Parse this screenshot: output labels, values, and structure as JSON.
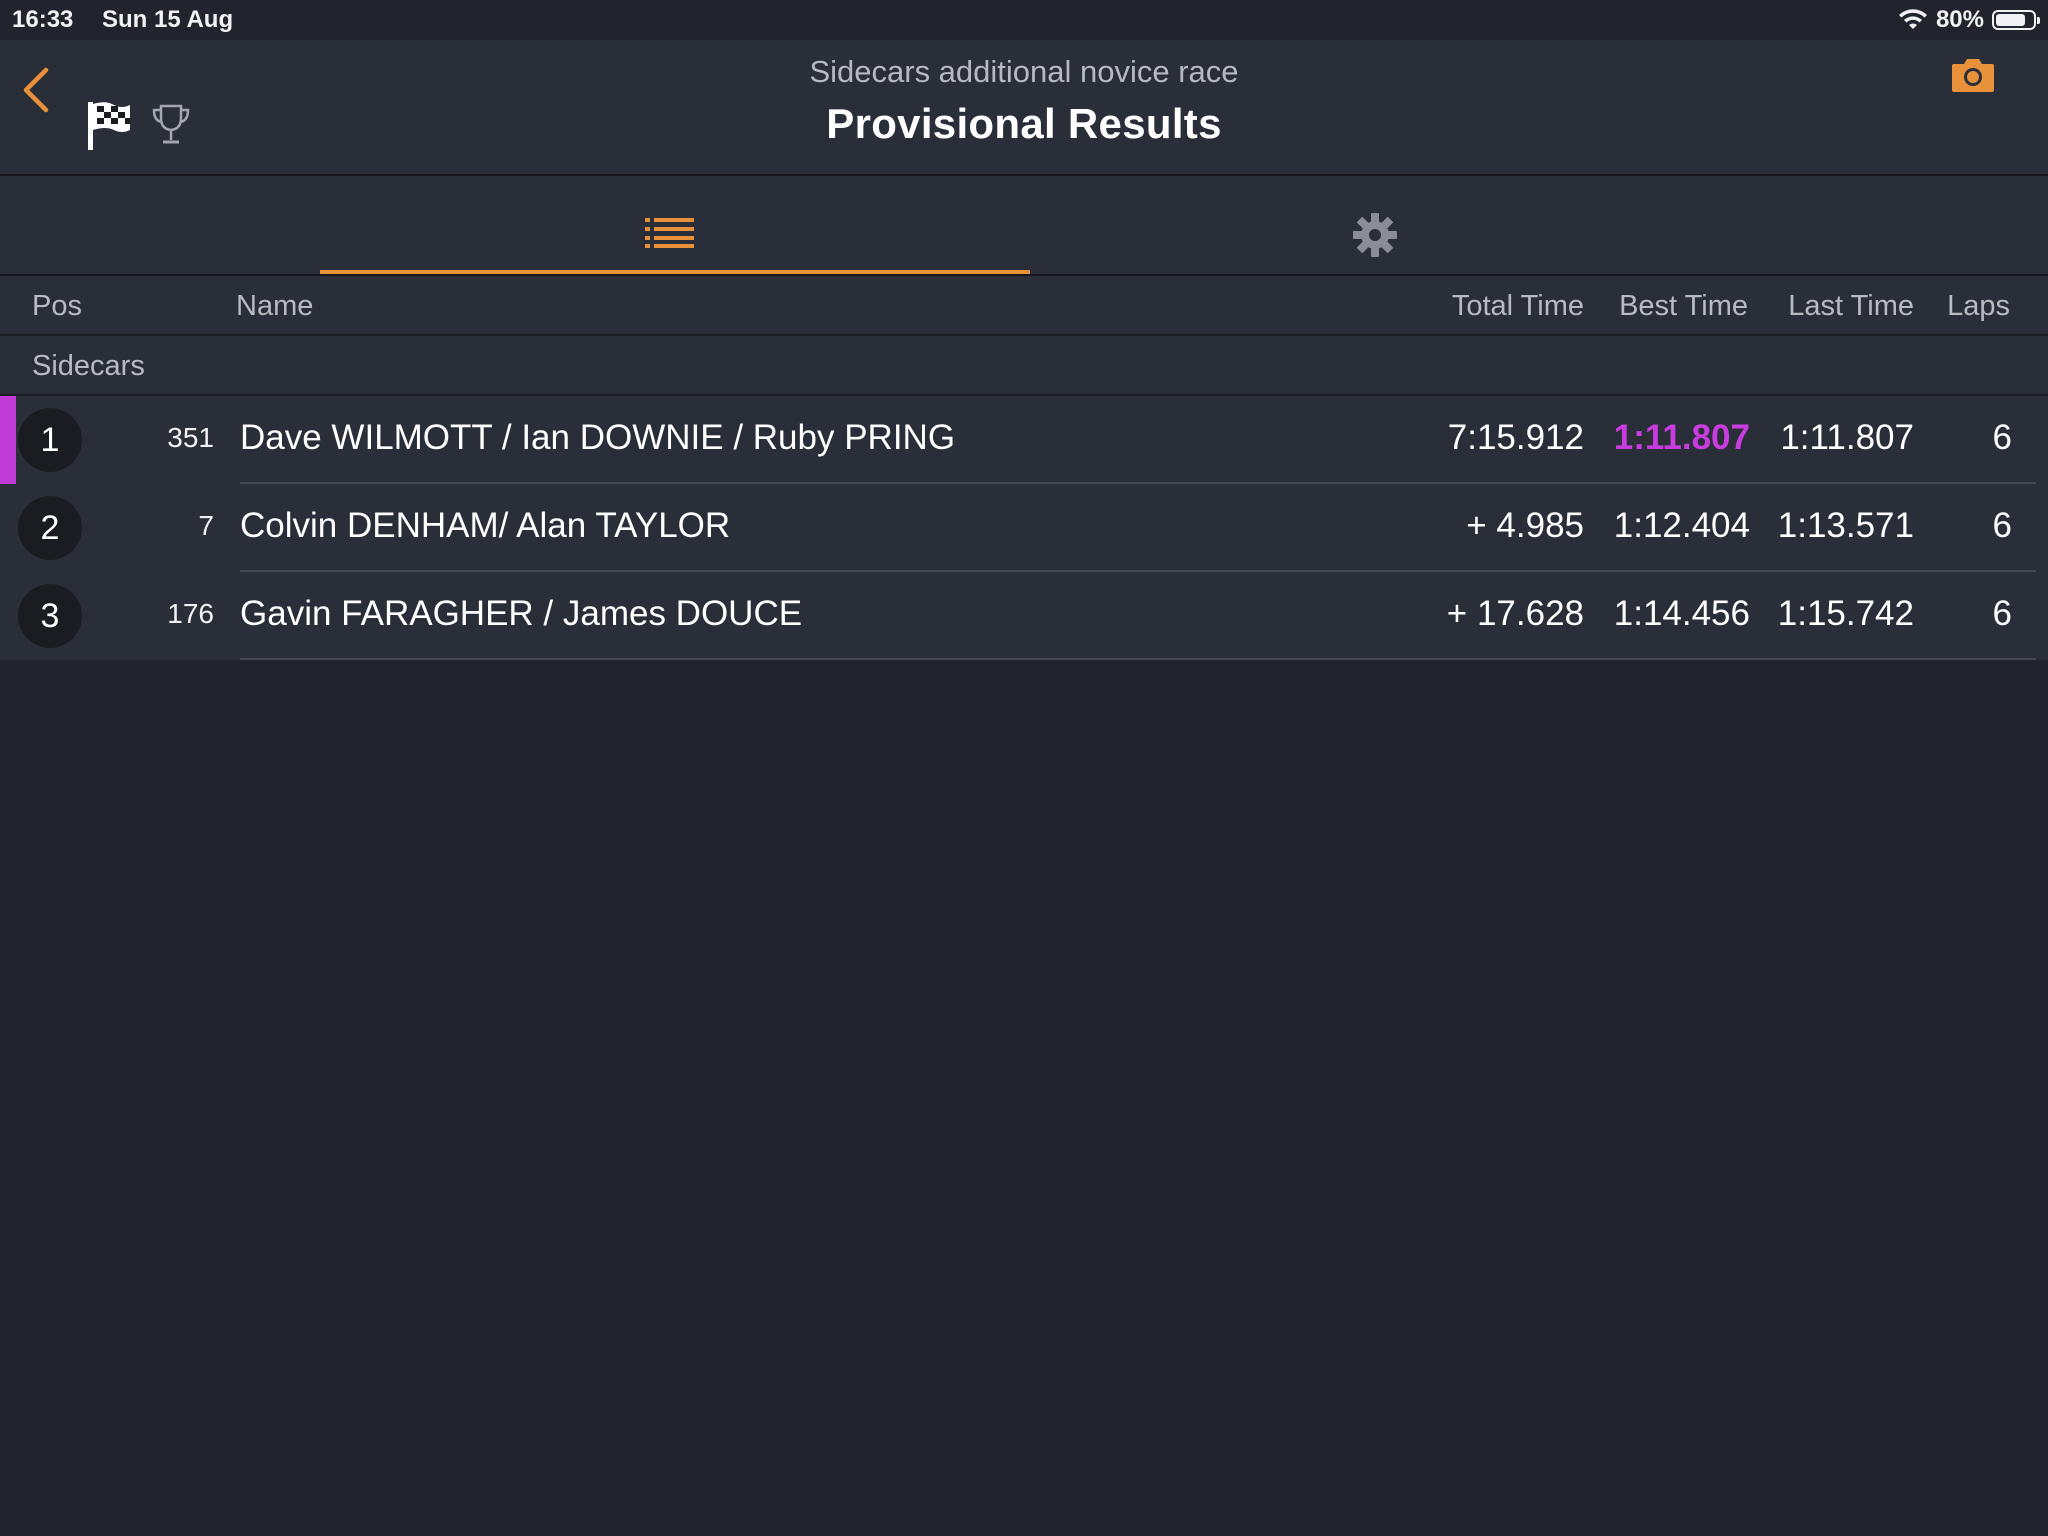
{
  "status_bar": {
    "time": "16:33",
    "date": "Sun 15 Aug",
    "battery": "80%",
    "battery_level": 0.8
  },
  "header": {
    "subtitle": "Sidecars additional novice race",
    "title": "Provisional Results"
  },
  "tabs": [
    {
      "name": "list",
      "icon": "list-icon",
      "active": true
    },
    {
      "name": "settings",
      "icon": "gear-icon",
      "active": false
    }
  ],
  "columns": {
    "pos": "Pos",
    "name": "Name",
    "total_time": "Total Time",
    "best_time": "Best Time",
    "last_time": "Last Time",
    "laps": "Laps"
  },
  "group": "Sidecars",
  "rows": [
    {
      "pos": "1",
      "number": "351",
      "name": "Dave WILMOTT / Ian DOWNIE / Ruby PRING",
      "total_time": "7:15.912",
      "best_time": "1:11.807",
      "last_time": "1:11.807",
      "laps": "6"
    },
    {
      "pos": "2",
      "number": "7",
      "name": "Colvin DENHAM/ Alan TAYLOR",
      "total_time": "+ 4.985",
      "best_time": "1:12.404",
      "last_time": "1:13.571",
      "laps": "6"
    },
    {
      "pos": "3",
      "number": "176",
      "name": "Gavin FARAGHER / James DOUCE",
      "total_time": "+ 17.628",
      "best_time": "1:14.456",
      "last_time": "1:15.742",
      "laps": "6"
    }
  ],
  "colors": {
    "accent": "#e8903a",
    "fastest_lap": "#c93ce0",
    "background": "#21242d"
  }
}
